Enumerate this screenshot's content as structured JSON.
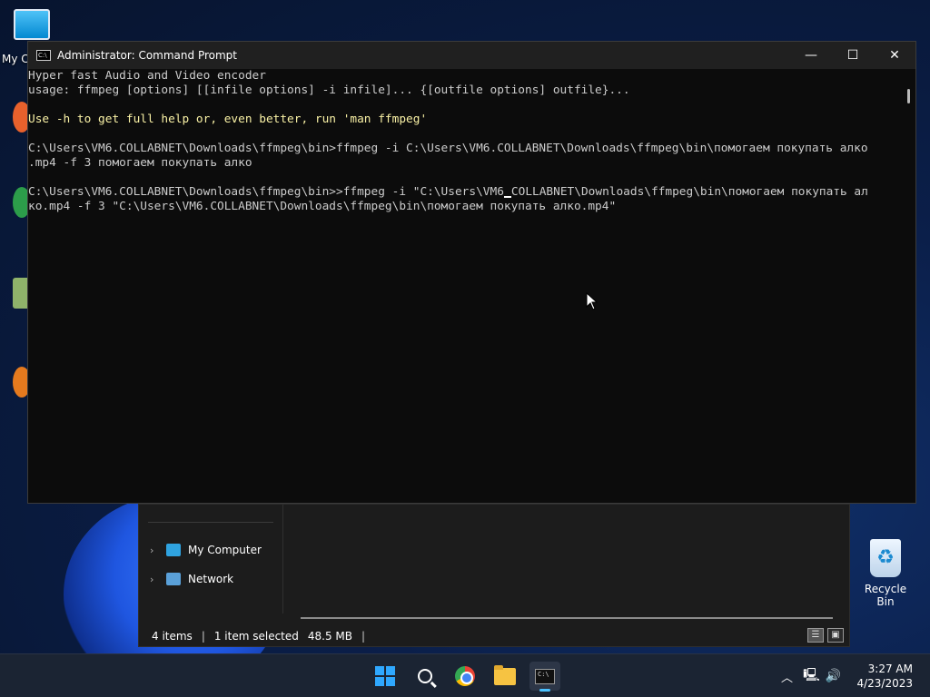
{
  "desktop": {
    "icons": [
      {
        "label": "My C"
      },
      {
        "label": "Recycle Bin"
      }
    ]
  },
  "explorer": {
    "nav": [
      {
        "label": "My Computer"
      },
      {
        "label": "Network"
      }
    ],
    "status": {
      "items": "4 items",
      "selected": "1 item selected",
      "size": "48.5 MB"
    }
  },
  "cmd": {
    "title": "Administrator: Command Prompt",
    "lines": [
      {
        "text": "Hyper fast Audio and Video encoder",
        "color": "default"
      },
      {
        "text": "usage: ffmpeg [options] [[infile options] -i infile]... {[outfile options] outfile}...",
        "color": "default"
      },
      {
        "text": "",
        "color": "default"
      },
      {
        "text": "Use -h to get full help or, even better, run 'man ffmpeg'",
        "color": "yellow"
      },
      {
        "text": "",
        "color": "default"
      },
      {
        "text": "C:\\Users\\VM6.COLLABNET\\Downloads\\ffmpeg\\bin>ffmpeg -i C:\\Users\\VM6.COLLABNET\\Downloads\\ffmpeg\\bin\\помогаем покупать алко",
        "color": "default"
      },
      {
        "text": ".mp4 -f 3 помогаем покупать алко",
        "color": "default"
      },
      {
        "text": "",
        "color": "default"
      },
      {
        "text": "C:\\Users\\VM6.COLLABNET\\Downloads\\ffmpeg\\bin>>ffmpeg -i \"C:\\Users\\VM6",
        "suffix": "COLLABNET\\Downloads\\ffmpeg\\bin\\помогаем покупать ал",
        "cursor": true,
        "color": "default"
      },
      {
        "text": "ко.mp4 -f 3 \"C:\\Users\\VM6.COLLABNET\\Downloads\\ffmpeg\\bin\\помогаем покупать алко.mp4\"",
        "color": "default"
      }
    ],
    "controls": {
      "minimize": "—",
      "maximize": "☐",
      "close": "✕"
    }
  },
  "taskbar": {
    "apps": [
      "start",
      "search",
      "chrome",
      "file-explorer",
      "command-prompt"
    ],
    "clock": {
      "time": "3:27 AM",
      "date": "4/23/2023"
    }
  },
  "colors": {
    "console_text": "#cccccc",
    "console_yellow": "#f9f1a5",
    "accent": "#4cc2ff"
  }
}
